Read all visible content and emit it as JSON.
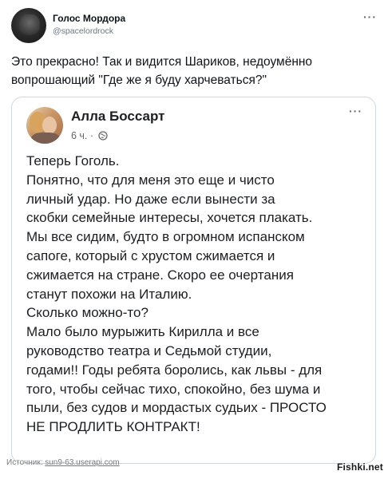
{
  "tweet": {
    "author_name": "Голос Мордора",
    "author_handle": "@spacelordrock",
    "more_icon": "more-horizontal-icon",
    "text_lines": [
      "Это прекрасно! Так и видится Шариков, недоумённо",
      "вопрошающий \"Где же я буду харчеваться?\""
    ]
  },
  "quoted_post": {
    "author_name": "Алла Боссарт",
    "time": "6 ч. ·",
    "privacy_icon": "globe-icon",
    "more_icon": "more-horizontal-icon",
    "text_lines": [
      "Теперь Гоголь.",
      "Понятно, что для меня это еще и чисто",
      "личный удар. Но даже если вынести за",
      "скобки семейные интересы, хочется плакать.",
      "Мы все сидим, будто в огромном испанском",
      "сапоге, который с хрустом сжимается и",
      "сжимается на стране. Скоро ее очертания",
      "станут похожи на Италию.",
      "Сколько можно-то?",
      "Мало было мурыжить Кирилла и все",
      "руководство театра и Седьмой студии,",
      "годами!! Годы ребята боролись, как львы - для",
      "того, чтобы сейчас тихо, спокойно, без шума и",
      "пыли, без судов и мордастых судьих - ПРОСТО",
      "НЕ ПРОДЛИТЬ КОНТРАКТ!"
    ]
  },
  "footer": {
    "source_label": "Источник:",
    "source_link": "sun9-63.userapi.com",
    "brand": "Fishki.net"
  }
}
